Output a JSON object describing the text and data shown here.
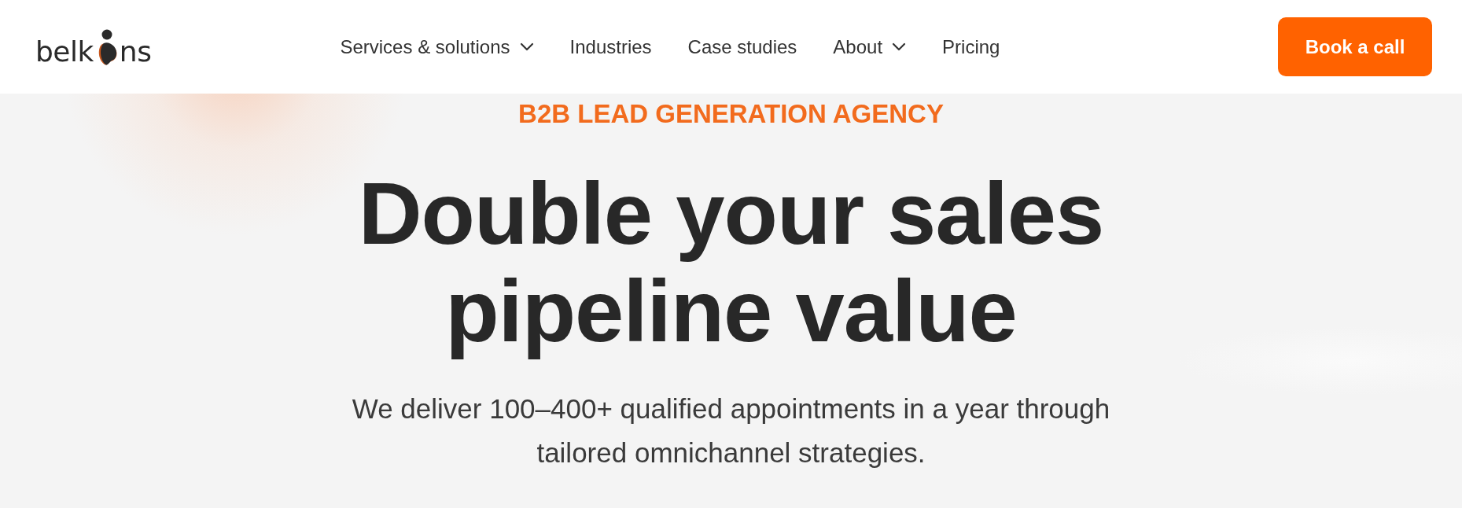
{
  "logo": {
    "before": "belk",
    "after": "ns"
  },
  "nav": [
    {
      "label": "Services & solutions",
      "dropdown": true
    },
    {
      "label": "Industries",
      "dropdown": false
    },
    {
      "label": "Case studies",
      "dropdown": false
    },
    {
      "label": "About",
      "dropdown": true
    },
    {
      "label": "Pricing",
      "dropdown": false
    }
  ],
  "cta": "Book a call",
  "hero": {
    "eyebrow": "B2B LEAD GENERATION AGENCY",
    "heading": [
      "Double your sales",
      "pipeline value"
    ],
    "subtitle": [
      "We deliver 100–400+ qualified appointments in a year through",
      "tailored omnichannel strategies."
    ]
  }
}
